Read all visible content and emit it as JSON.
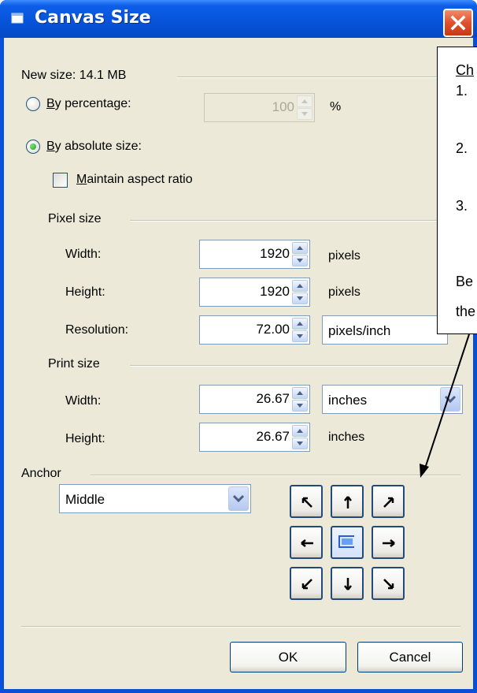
{
  "window": {
    "title": "Canvas Size"
  },
  "new_size": "New size: 14.1 MB",
  "by_percentage": {
    "label_underline": "B",
    "label_rest": "y percentage:",
    "value": "100",
    "unit": "%",
    "selected": false
  },
  "by_absolute": {
    "label_underline": "B",
    "label_rest": "y absolute size:",
    "selected": true
  },
  "maintain_aspect": {
    "label_underline": "M",
    "label_rest": "aintain aspect ratio",
    "checked": false
  },
  "pixel_size": {
    "heading": "Pixel size",
    "width_label": "Width:",
    "width_value": "1920",
    "width_unit": "pixels",
    "height_label": "Height:",
    "height_value": "1920",
    "height_unit": "pixels",
    "resolution_label": "Resolution:",
    "resolution_value": "72.00",
    "resolution_unit": "pixels/inch"
  },
  "print_size": {
    "heading": "Print size",
    "width_label": "Width:",
    "width_value": "26.67",
    "width_unit_select": "inches",
    "height_label": "Height:",
    "height_value": "26.67",
    "height_unit": "inches"
  },
  "anchor": {
    "heading": "Anchor",
    "select_value": "Middle",
    "selected_cell": "middle"
  },
  "buttons": {
    "ok": "OK",
    "cancel": "Cancel"
  },
  "callout": {
    "line1": "Ch",
    "line2": "1.",
    "line3": "2.",
    "line4": "3.",
    "line5": "Be",
    "line6": "the"
  },
  "colors": {
    "titlebar": "#0653d8",
    "dialog_bg": "#ece9d8",
    "close": "#e0502c"
  }
}
